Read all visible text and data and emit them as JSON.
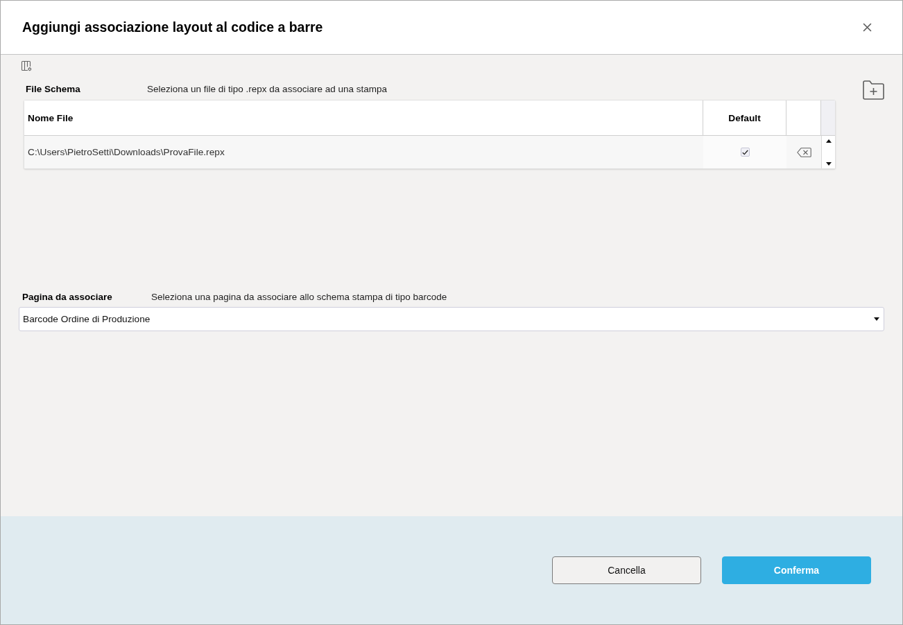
{
  "dialog": {
    "title": "Aggiungi associazione layout al codice a barre"
  },
  "file_schema": {
    "label": "File Schema",
    "description": "Seleziona un file di tipo .repx da associare ad una stampa",
    "table": {
      "columns": [
        {
          "label": "Nome File"
        },
        {
          "label": "Default"
        }
      ],
      "rows": [
        {
          "file": "C:\\Users\\PietroSetti\\Downloads\\ProvaFile.repx",
          "default": true
        }
      ]
    }
  },
  "page_selection": {
    "label": "Pagina da associare",
    "description": "Seleziona una pagina da associare allo schema stampa di tipo barcode",
    "dropdown": {
      "value": "Barcode Ordine di Produzione"
    }
  },
  "buttons": [
    {
      "label": "Cancella",
      "kind": "secondary"
    },
    {
      "label": "Conferma",
      "kind": "primary"
    }
  ]
}
